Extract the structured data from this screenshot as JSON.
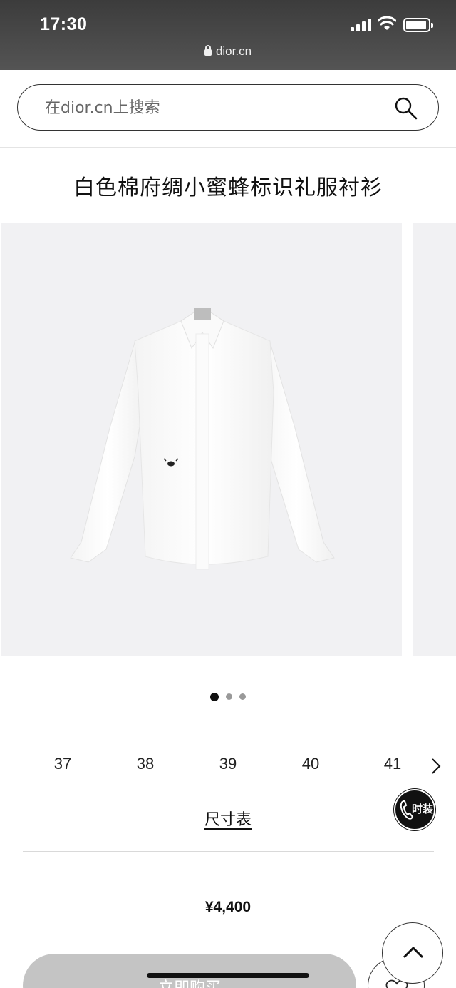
{
  "status_bar": {
    "time": "17:30"
  },
  "browser": {
    "url": "dior.cn"
  },
  "search": {
    "placeholder": "在dior.cn上搜索"
  },
  "product": {
    "title": "白色棉府绸小蜜蜂标识礼服衬衫",
    "price": "¥4,400",
    "carousel": {
      "total_slides": 3,
      "active_index": 0
    }
  },
  "sizes": [
    "37",
    "38",
    "39",
    "40",
    "41"
  ],
  "size_chart_label": "尺寸表",
  "badge_label": "时装",
  "buy_button_label": "立即购买",
  "icons": [
    "lock-icon",
    "search-icon",
    "chevron-right-icon",
    "phone-icon",
    "chevron-up-icon",
    "heart-icon"
  ]
}
